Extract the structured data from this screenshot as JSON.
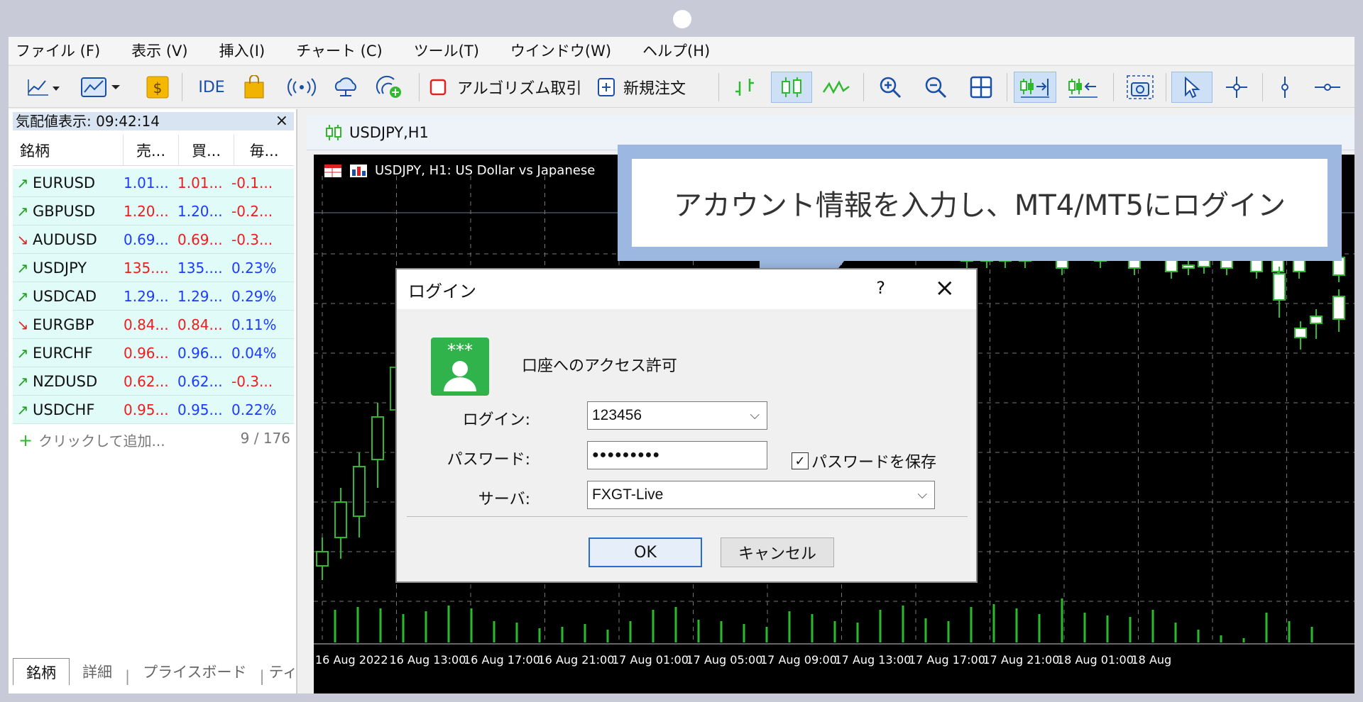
{
  "menu": [
    "ファイル (F)",
    "表示 (V)",
    "挿入(I)",
    "チャート (C)",
    "ツール(T)",
    "ウインドウ(W)",
    "ヘルプ(H)"
  ],
  "toolbar": {
    "ide_label": "IDE",
    "algo_label": "アルゴリズム取引",
    "new_order_label": "新規注文"
  },
  "market_watch": {
    "title": "気配値表示: 09:42:14",
    "close_glyph": "×",
    "headers": {
      "symbol": "銘柄",
      "bid": "売...",
      "ask": "買...",
      "change": "毎..."
    },
    "rows": [
      {
        "dir": "up",
        "symbol": "EURUSD",
        "bid": "1.01...",
        "ask": "1.01...",
        "change": "-0.1...",
        "bid_color": "#1a3cff",
        "ask_color": "#ee1c1c",
        "chg_color": "#ee1c1c"
      },
      {
        "dir": "up",
        "symbol": "GBPUSD",
        "bid": "1.20...",
        "ask": "1.20...",
        "change": "-0.2...",
        "bid_color": "#ee1c1c",
        "ask_color": "#1a3cff",
        "chg_color": "#ee1c1c"
      },
      {
        "dir": "down",
        "symbol": "AUDUSD",
        "bid": "0.69...",
        "ask": "0.69...",
        "change": "-0.3...",
        "bid_color": "#1a3cff",
        "ask_color": "#ee1c1c",
        "chg_color": "#ee1c1c"
      },
      {
        "dir": "up",
        "symbol": "USDJPY",
        "bid": "135....",
        "ask": "135....",
        "change": "0.23%",
        "bid_color": "#ee1c1c",
        "ask_color": "#1a3cff",
        "chg_color": "#1a3cff"
      },
      {
        "dir": "up",
        "symbol": "USDCAD",
        "bid": "1.29...",
        "ask": "1.29...",
        "change": "0.29%",
        "bid_color": "#1a3cff",
        "ask_color": "#1a3cff",
        "chg_color": "#1a3cff"
      },
      {
        "dir": "down",
        "symbol": "EURGBP",
        "bid": "0.84...",
        "ask": "0.84...",
        "change": "0.11%",
        "bid_color": "#ee1c1c",
        "ask_color": "#ee1c1c",
        "chg_color": "#1a3cff"
      },
      {
        "dir": "up",
        "symbol": "EURCHF",
        "bid": "0.96...",
        "ask": "0.96...",
        "change": "0.04%",
        "bid_color": "#ee1c1c",
        "ask_color": "#1a3cff",
        "chg_color": "#1a3cff"
      },
      {
        "dir": "up",
        "symbol": "NZDUSD",
        "bid": "0.62...",
        "ask": "0.62...",
        "change": "-0.3...",
        "bid_color": "#ee1c1c",
        "ask_color": "#1a3cff",
        "chg_color": "#ee1c1c"
      },
      {
        "dir": "up",
        "symbol": "USDCHF",
        "bid": "0.95...",
        "ask": "0.95...",
        "change": "0.22%",
        "bid_color": "#ee1c1c",
        "ask_color": "#1a3cff",
        "chg_color": "#1a3cff"
      }
    ],
    "add_label": "クリックして追加...",
    "count": "9 / 176",
    "tabs": [
      "銘柄",
      "詳細",
      "プライスボード",
      "ティ"
    ]
  },
  "chart": {
    "tab_label": "USDJPY,H1",
    "header": "USDJPY, H1:  US Dollar vs Japanese",
    "time_labels": [
      "16 Aug 2022",
      "16 Aug 13:00",
      "16 Aug 17:00",
      "16 Aug 21:00",
      "17 Aug 01:00",
      "17 Aug 05:00",
      "17 Aug 09:00",
      "17 Aug 13:00",
      "17 Aug 17:00",
      "17 Aug 21:00",
      "18 Aug 01:00",
      "18 Aug"
    ]
  },
  "callout": {
    "text": "アカウント情報を入力し、MT4/MT5にログイン"
  },
  "dialog": {
    "title": "ログイン",
    "help": "?",
    "close": "×",
    "icon_stars": "***",
    "subtitle": "口座へのアクセス許可",
    "login_label": "ログイン:",
    "login_value": "123456",
    "password_label": "パスワード:",
    "password_value": "●●●●●●●●●",
    "save_password_label": "パスワードを保存",
    "save_password_checked": true,
    "server_label": "サーバ:",
    "server_value": "FXGT-Live",
    "ok_label": "OK",
    "cancel_label": "キャンセル"
  },
  "colors": {
    "accent": "#2a6ec7",
    "up": "#2dbb2d",
    "callout": "#9cb8e1",
    "row_bg": "#e0fbf8"
  }
}
